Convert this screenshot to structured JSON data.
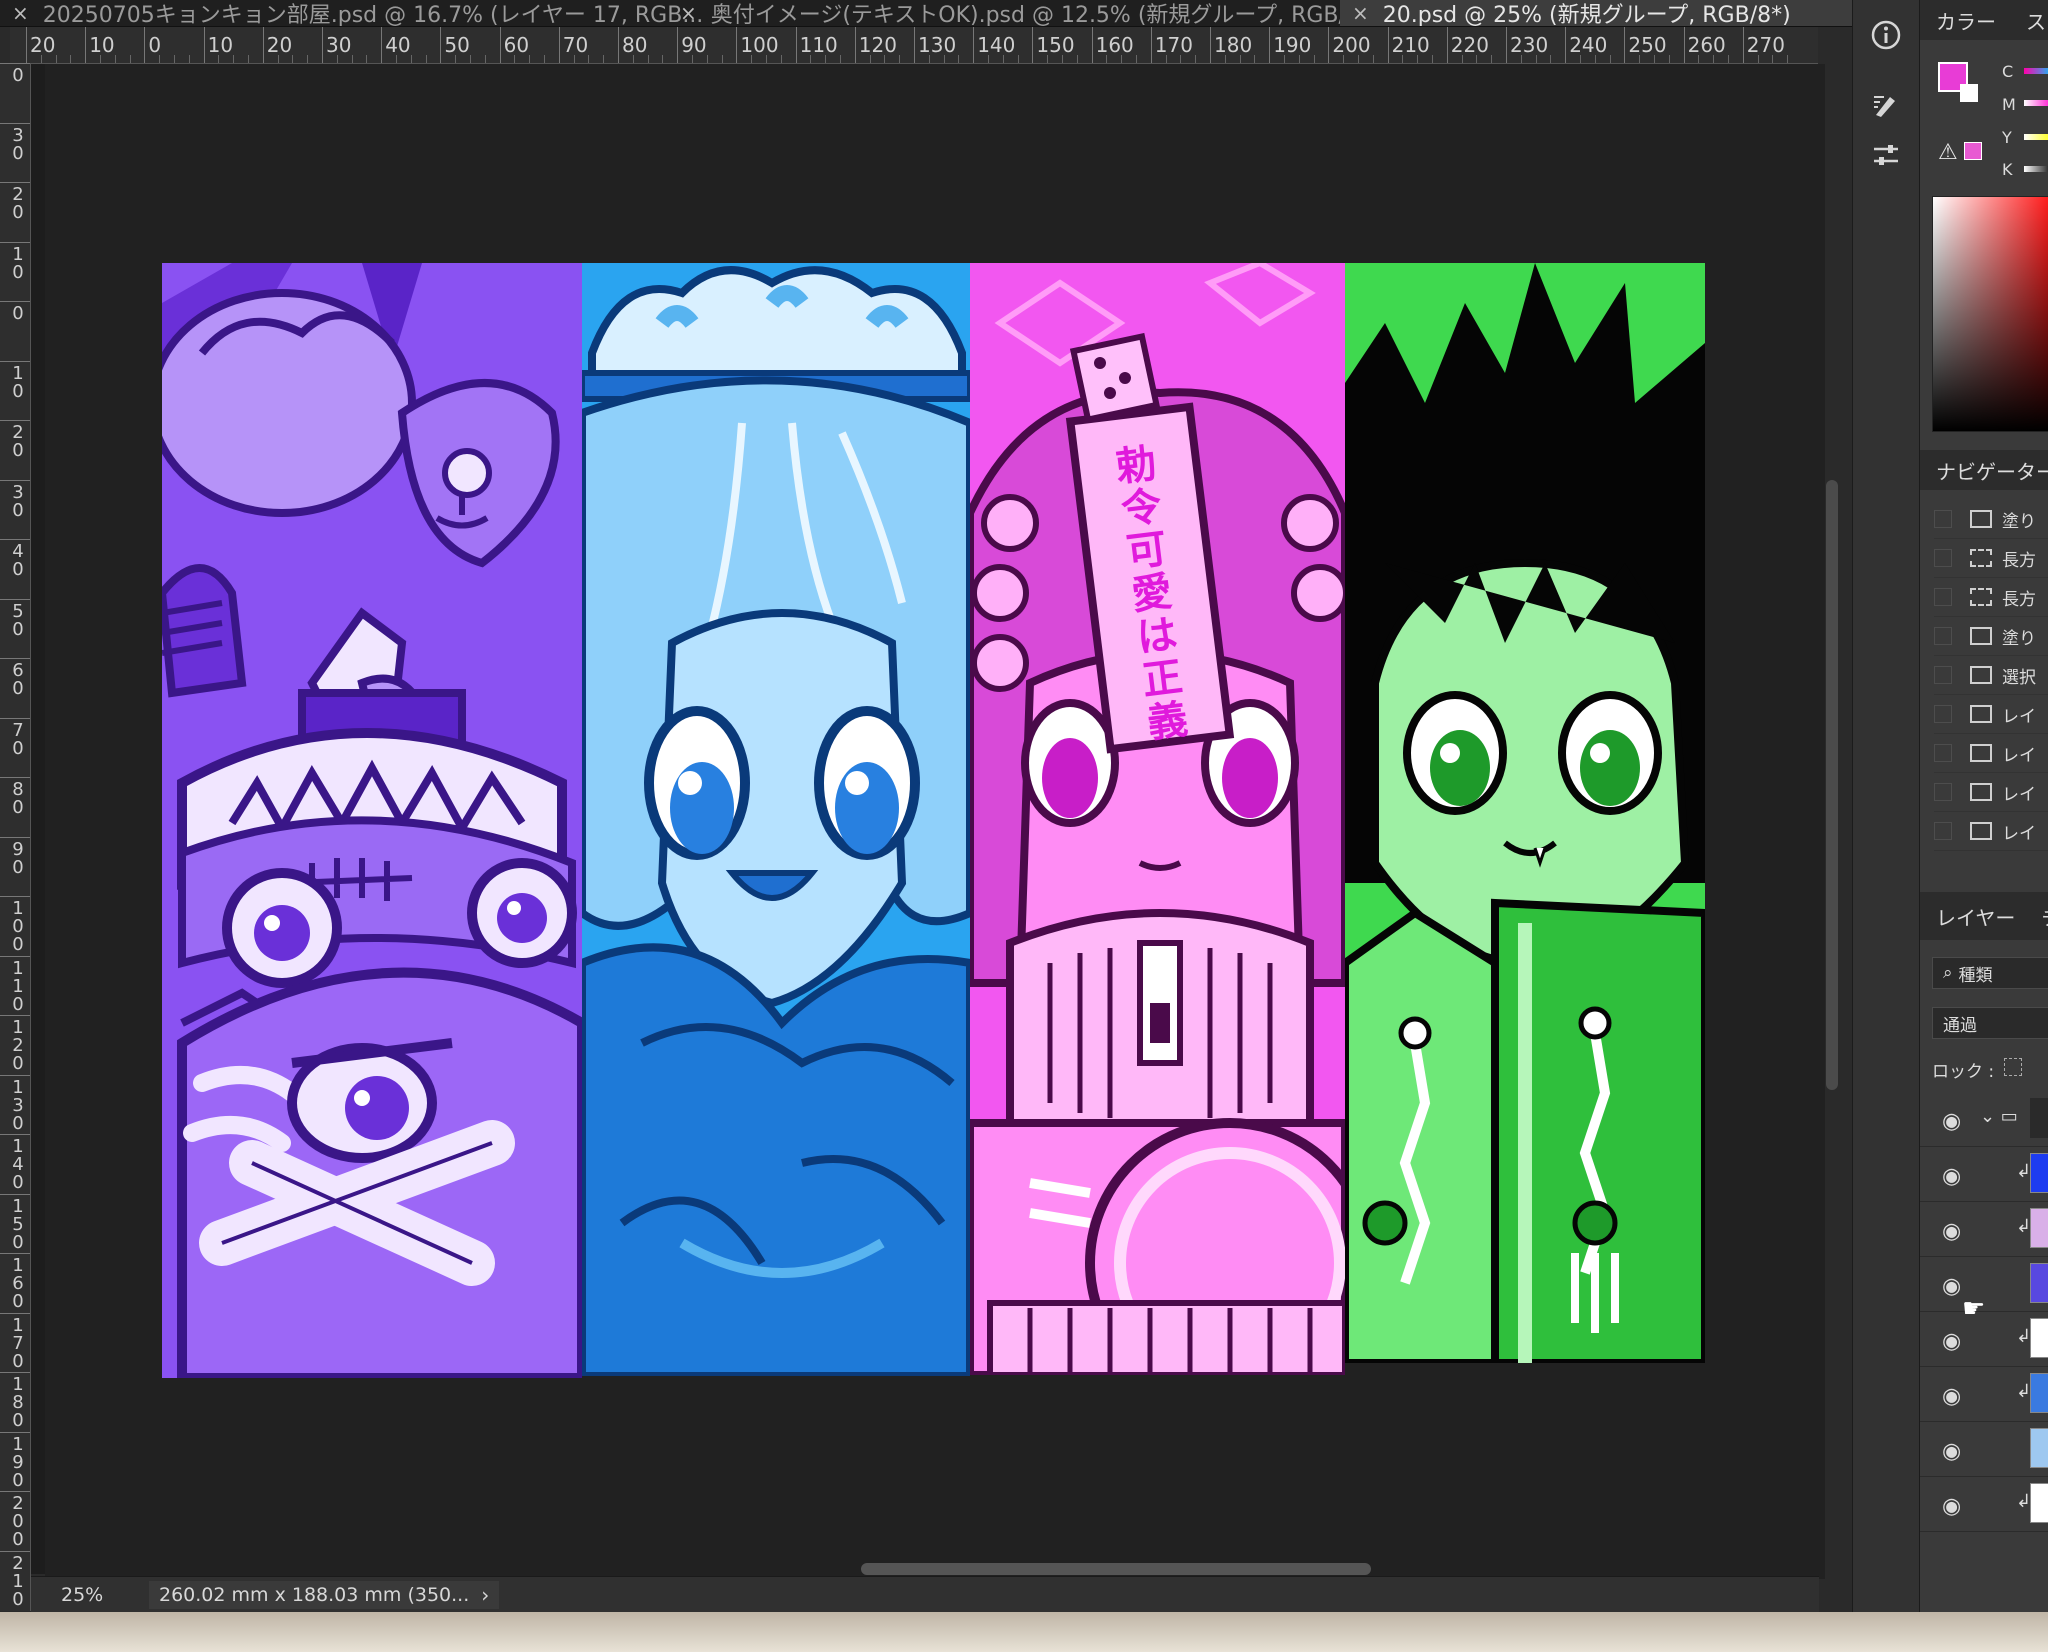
{
  "tabs": [
    {
      "label": "20250705キョンキョン部屋.psd @ 16.7% (レイヤー 17, RGB...",
      "active": false
    },
    {
      "label": "奥付イメージ(テキストOK).psd @ 12.5% (新規グループ, RGB/8...",
      "active": false
    },
    {
      "label": "20.psd @ 25% (新規グループ, RGB/8*)",
      "active": true
    }
  ],
  "close_glyph": "×",
  "ruler_top": [
    "20",
    "10",
    "0",
    "10",
    "20",
    "30",
    "40",
    "50",
    "60",
    "70",
    "80",
    "90",
    "100",
    "110",
    "120",
    "130",
    "140",
    "150",
    "160",
    "170",
    "180",
    "190",
    "200",
    "210",
    "220",
    "230",
    "240",
    "250",
    "260",
    "270"
  ],
  "ruler_left": [
    "0",
    "30",
    "20",
    "10",
    "0",
    "10",
    "20",
    "30",
    "40",
    "50",
    "60",
    "70",
    "80",
    "90",
    "100",
    "110",
    "120",
    "130",
    "140",
    "150",
    "160",
    "170",
    "180",
    "190",
    "200",
    "210"
  ],
  "status": {
    "zoom": "25%",
    "doc_info": "260.02 mm x 188.03 mm (350...",
    "chevron": "›"
  },
  "artwork": {
    "panels": [
      {
        "name": "purple",
        "bg": "#8a52f2"
      },
      {
        "name": "blue",
        "bg": "#2aa4f0"
      },
      {
        "name": "pink",
        "bg": "#f257f0"
      },
      {
        "name": "green",
        "bg": "#3fd94f"
      }
    ],
    "charm_text": [
      "勅",
      "令",
      "可",
      "愛",
      "は",
      "正",
      "義"
    ]
  },
  "toolbar": {
    "tools": [
      "info-icon",
      "brush-settings-icon",
      "adjust-icon"
    ]
  },
  "color_panel": {
    "title": "カラー",
    "second_tab": "ス",
    "channels": [
      "C",
      "M",
      "Y",
      "K"
    ],
    "fg_color": "#e83cd6",
    "bg_color": "#ffffff"
  },
  "navigator": {
    "title": "ナビゲーター",
    "items": [
      {
        "label": "塗り",
        "icon": "layer"
      },
      {
        "label": "長方",
        "icon": "marquee"
      },
      {
        "label": "長方",
        "icon": "marquee"
      },
      {
        "label": "塗り",
        "icon": "layer"
      },
      {
        "label": "選択",
        "icon": "doc"
      },
      {
        "label": "レイ",
        "icon": "doc"
      },
      {
        "label": "レイ",
        "icon": "doc"
      },
      {
        "label": "レイ",
        "icon": "doc"
      },
      {
        "label": "レイ",
        "icon": "doc"
      }
    ]
  },
  "layers_panel": {
    "title": "レイヤー",
    "second_tab": "チ",
    "filter_label": "種類",
    "blend_mode": "通過",
    "lock_label": "ロック :",
    "rows": [
      {
        "type": "group",
        "thumb": "#2a2a2a"
      },
      {
        "type": "clipped",
        "thumb": "#1d3cf0"
      },
      {
        "type": "clipped",
        "thumb": "#d9b0e8"
      },
      {
        "type": "normal",
        "thumb": "#5848e0"
      },
      {
        "type": "clipped",
        "thumb": "#ffffff"
      },
      {
        "type": "clipped",
        "thumb": "#3a7ae0"
      },
      {
        "type": "normal",
        "thumb": "#9ec8f0"
      },
      {
        "type": "clipped",
        "thumb": "#ffffff"
      }
    ]
  }
}
